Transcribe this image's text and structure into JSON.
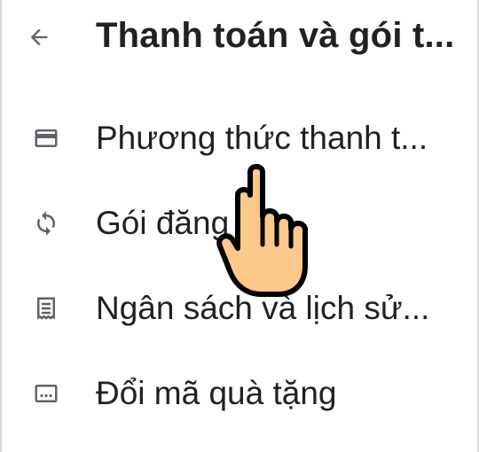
{
  "appbar": {
    "title": "Thanh toán và gói t...",
    "back_icon": "arrow-left-icon"
  },
  "menu": {
    "items": [
      {
        "label": "Phương thức thanh t...",
        "icon": "credit-card-icon"
      },
      {
        "label": "Gói đăng ký",
        "icon": "sync-icon"
      },
      {
        "label": "Ngân sách và lịch sử...",
        "icon": "receipt-icon"
      },
      {
        "label": "Đổi mã quà tặng",
        "icon": "gift-card-icon"
      }
    ]
  },
  "colors": {
    "text": "#202124",
    "icon": "#5f6368",
    "hand_fill": "#fcc98b",
    "hand_stroke": "#000000"
  }
}
